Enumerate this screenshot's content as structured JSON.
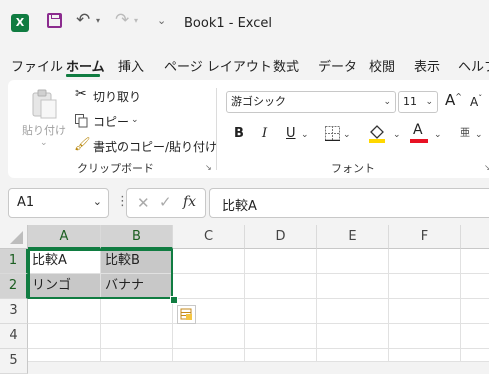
{
  "titlebar": {
    "app_logo": "X",
    "doc_title": "Book1  -  Excel",
    "undo_icon": "↶",
    "redo_icon": "↷"
  },
  "tabs": [
    {
      "label": "ファイル"
    },
    {
      "label": "ホーム"
    },
    {
      "label": "挿入"
    },
    {
      "label": "ページ レイアウト"
    },
    {
      "label": "数式"
    },
    {
      "label": "データ"
    },
    {
      "label": "校閲"
    },
    {
      "label": "表示"
    },
    {
      "label": "ヘルプ"
    }
  ],
  "ribbon": {
    "clipboard": {
      "paste_label": "貼り付け",
      "cut_label": "切り取り",
      "copy_label": "コピー",
      "format_painter_label": "書式のコピー/貼り付け",
      "group_label": "クリップボード"
    },
    "font": {
      "font_name": "游ゴシック",
      "font_size": "11",
      "grow_label": "A",
      "shrink_label": "A",
      "bold_label": "B",
      "italic_label": "I",
      "underline_label": "U",
      "font_color_label": "A",
      "phonetic_label": "亜",
      "group_label": "フォント"
    }
  },
  "formula_bar": {
    "name_box": "A1",
    "fx_label": "fx",
    "content": "比較A"
  },
  "sheet": {
    "columns": [
      "A",
      "B",
      "C",
      "D",
      "E",
      "F"
    ],
    "rows": [
      "1",
      "2",
      "3",
      "4",
      "5"
    ],
    "cells": {
      "A1": "比較A",
      "B1": "比較B",
      "A2": "リンゴ",
      "B2": "バナナ"
    }
  },
  "colors": {
    "excel_green": "#107c41",
    "fill_highlight": "#ffd800",
    "font_color": "#e81123"
  }
}
